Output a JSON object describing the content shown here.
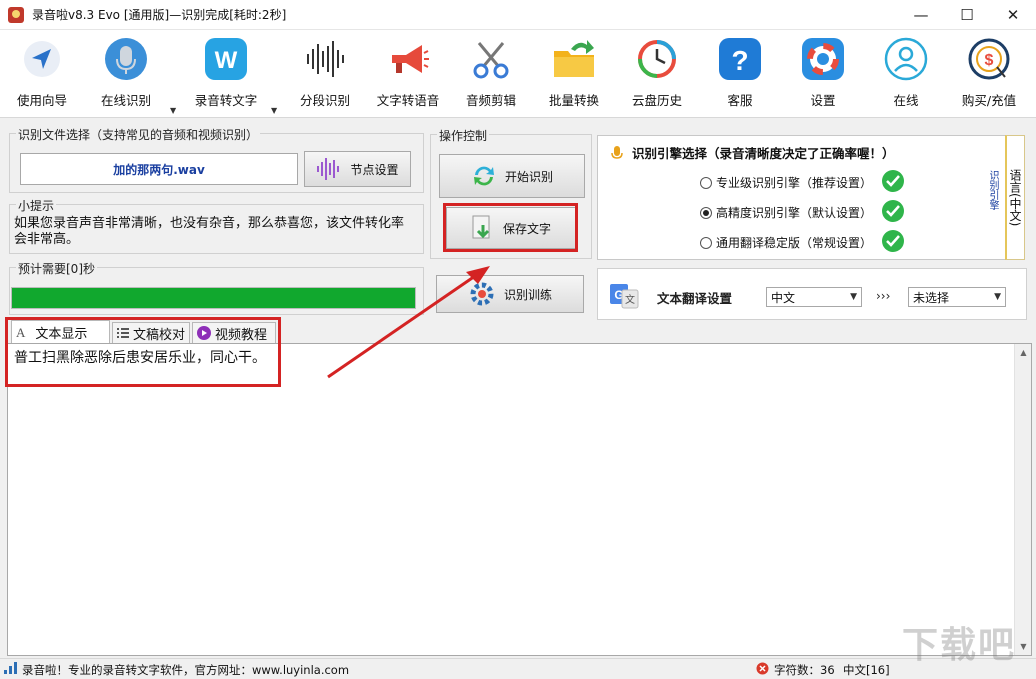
{
  "window": {
    "title": "录音啦v8.3 Evo [通用版]—识别完成[耗时:2秒]",
    "minimize": "—",
    "maximize": "☐",
    "close": "✕"
  },
  "toolbar": {
    "items": [
      {
        "label": "使用向导",
        "icon": "navigation-arrow-icon"
      },
      {
        "label": "在线识别",
        "icon": "microphone-icon"
      },
      {
        "label": "录音转文字",
        "icon": "w-logo-icon"
      },
      {
        "label": "分段识别",
        "icon": "waveform-icon"
      },
      {
        "label": "文字转语音",
        "icon": "megaphone-icon"
      },
      {
        "label": "音频剪辑",
        "icon": "scissors-icon"
      },
      {
        "label": "批量转换",
        "icon": "folder-arrow-icon"
      },
      {
        "label": "云盘历史",
        "icon": "history-clock-icon"
      },
      {
        "label": "客服",
        "icon": "help-question-icon"
      },
      {
        "label": "设置",
        "icon": "settings-lifebuoy-icon"
      },
      {
        "label": "在线",
        "icon": "user-online-icon"
      },
      {
        "label": "购买/充值",
        "icon": "purchase-coin-icon"
      }
    ],
    "dropdown_arrow": "▼"
  },
  "file_select": {
    "group_title": "识别文件选择（支持常见的音频和视频识别）",
    "file_name": "加的那两句.wav",
    "node_button": "节点设置"
  },
  "hint": {
    "group_title": "小提示",
    "text": "如果您录音声音非常清晰，也没有杂音，那么恭喜您，该文件转化率会非常高。"
  },
  "progress": {
    "group_title": "预计需要[0]秒",
    "value_percent": 100,
    "color": "#11a82e"
  },
  "operation": {
    "group_title": "操作控制",
    "start_button": "开始识别",
    "save_button": "保存文字",
    "train_button": "识别训练"
  },
  "engine": {
    "title": "识别引擎选择（录音清晰度决定了正确率喔！）",
    "options": [
      {
        "label": "专业级识别引擎（推荐设置）",
        "checked": false
      },
      {
        "label": "高精度识别引擎（默认设置）",
        "checked": true
      },
      {
        "label": "通用翻译稳定版（常规设置）",
        "checked": false
      }
    ],
    "side_label": "识别引擎",
    "language_tab": "语言(中文)"
  },
  "translate": {
    "label": "文本翻译设置",
    "source": "中文",
    "arrows": "›››",
    "target": "未选择"
  },
  "tabs": [
    {
      "label": "文本显示",
      "active": true
    },
    {
      "label": "文稿校对",
      "active": false
    },
    {
      "label": "视频教程",
      "active": false
    }
  ],
  "content": {
    "text": "普工扫黑除恶除后患安居乐业，同心干。"
  },
  "status": {
    "left": "录音啦！专业的录音转文字软件，官方网址：www.luyinla.com",
    "char_count": "字符数：36",
    "lang": "中文[16]"
  },
  "watermark": "下载吧",
  "colors": {
    "annotation_red": "#d42323",
    "accent_blue": "#1a3fa0",
    "ok_green": "#2fb54a"
  }
}
